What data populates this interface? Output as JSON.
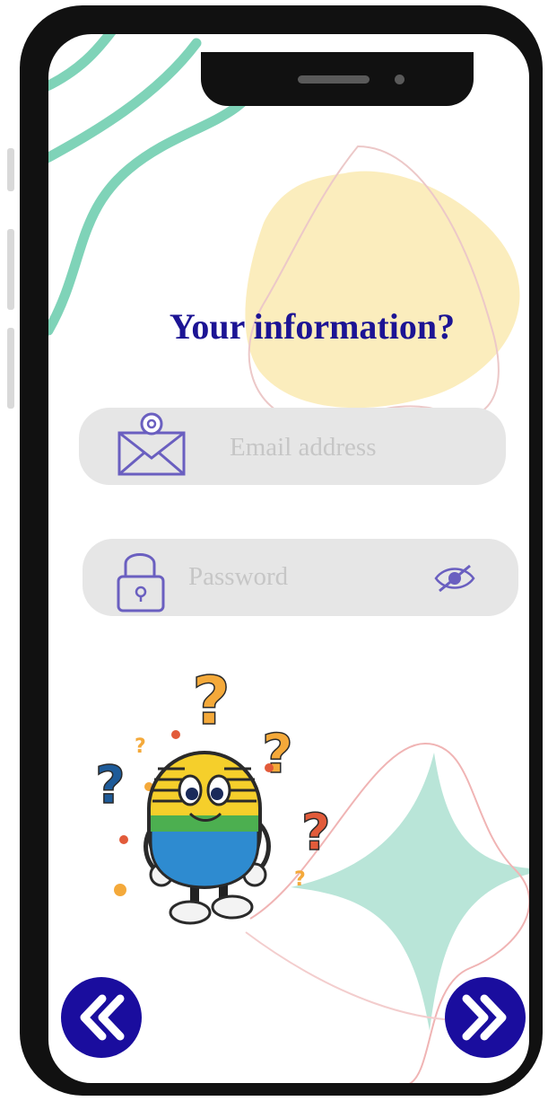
{
  "colors": {
    "title": "#1c1494",
    "accent_teal": "#7fd3b8",
    "accent_yellow": "#fbedbd",
    "nav_button": "#1a0d9e",
    "icon_stroke": "#6a5fc0",
    "field_bg": "#e6e6e6",
    "placeholder": "#c6c6c6"
  },
  "screen": {
    "title": "Your information?"
  },
  "email": {
    "placeholder": "Email address",
    "icon": "email-envelope-icon"
  },
  "password": {
    "placeholder": "Password",
    "icon": "padlock-icon",
    "toggle_icon": "eye-slash-icon"
  },
  "mascot": {
    "name": "microphone-mascot",
    "decorations": "question-marks"
  },
  "nav": {
    "back_icon": "double-chevron-left-icon",
    "next_icon": "double-chevron-right-icon"
  }
}
